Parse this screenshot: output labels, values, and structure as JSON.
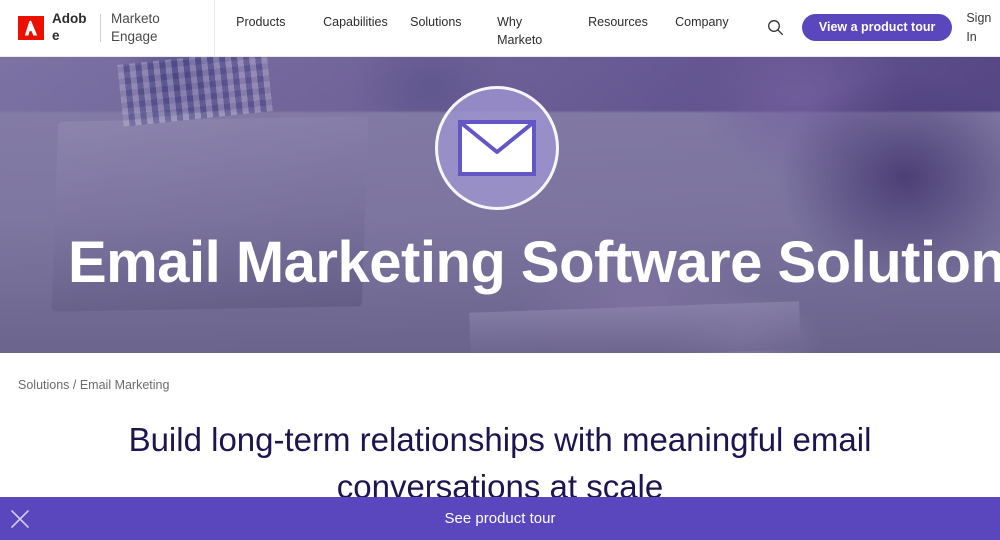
{
  "header": {
    "brand": {
      "logo_icon": "adobe-logo-icon",
      "name": "Adobe",
      "sub_name": "Marketo Engage"
    },
    "nav_items": [
      {
        "label": "Products"
      },
      {
        "label": "Capabilities"
      },
      {
        "label": "Solutions"
      },
      {
        "label": "Why Marketo"
      },
      {
        "label": "Resources"
      },
      {
        "label": "Company"
      }
    ],
    "search_icon": "search-icon",
    "tour_button_label": "View a product tour",
    "sign_in_label": "Sign In",
    "accent_color": "#5a46bd"
  },
  "hero": {
    "icon": "envelope-icon",
    "title": "Email Marketing Software Solution",
    "overlay_color": "#5c49a0"
  },
  "content": {
    "breadcrumb": "Solutions / Email Marketing",
    "heading": "Build long-term relationships with meaningful email conversations at scale",
    "heading_color": "#1e1450"
  },
  "banner": {
    "text": "See product tour",
    "close_icon": "close-icon",
    "background_color": "#5a46bd"
  }
}
